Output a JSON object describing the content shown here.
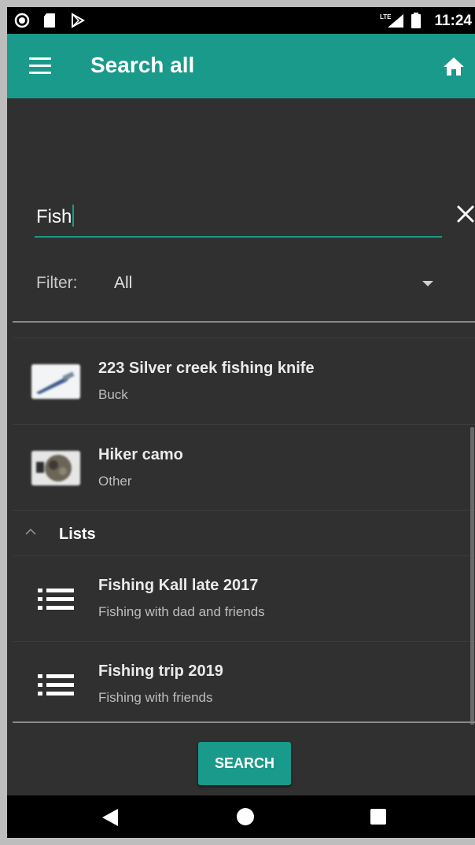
{
  "status_bar": {
    "time": "11:24",
    "network": "LTE"
  },
  "app_bar": {
    "title": "Search all",
    "menu_icon": "menu-icon",
    "home_icon": "home-icon"
  },
  "search": {
    "value": "Fish",
    "clear_icon": "close-icon"
  },
  "filter": {
    "label": "Filter:",
    "value": "All"
  },
  "items": [
    {
      "title": "223 Silver creek fishing knife",
      "subtitle": "Buck",
      "thumb": "knife-photo"
    },
    {
      "title": "Hiker camo",
      "subtitle": "Other",
      "thumb": "camo-photo"
    }
  ],
  "lists_section": {
    "label": "Lists",
    "items": [
      {
        "title": "Fishing Kall late 2017",
        "subtitle": "Fishing with dad and friends"
      },
      {
        "title": "Fishing trip 2019",
        "subtitle": "Fishing with friends"
      }
    ]
  },
  "search_button": {
    "label": "SEARCH"
  },
  "colors": {
    "accent": "#1a9a8a",
    "background": "#303030"
  }
}
